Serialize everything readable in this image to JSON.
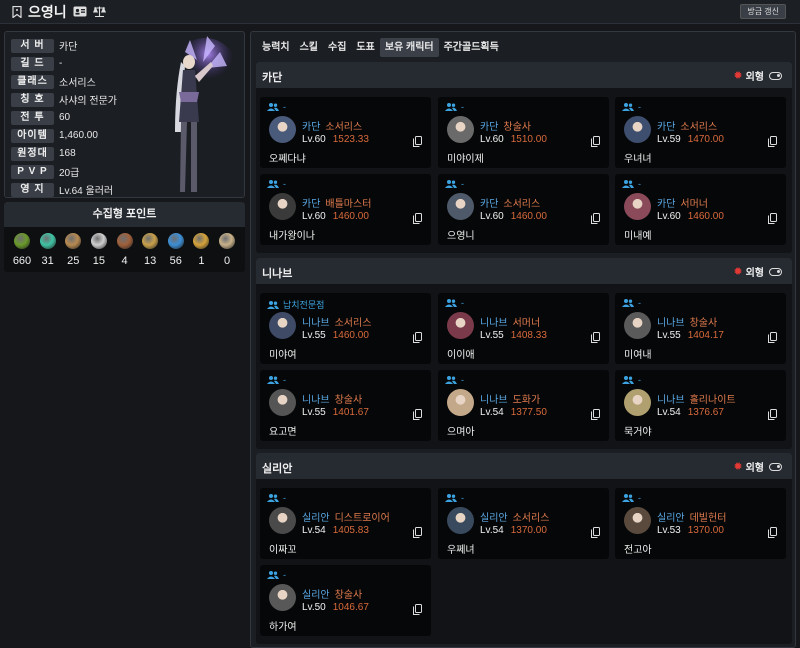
{
  "header": {
    "name": "으영니",
    "refresh_label": "방금 갱신"
  },
  "profile": {
    "rows": [
      {
        "label": "서 버",
        "value": "카단"
      },
      {
        "label": "길 드",
        "value": "-"
      },
      {
        "label": "클래스",
        "value": "소서리스"
      },
      {
        "label": "칭 호",
        "value": "사샤의 전문가"
      },
      {
        "label": "전 투",
        "value": "60"
      },
      {
        "label": "아이템",
        "value": "1,460.00"
      },
      {
        "label": "원정대",
        "value": "168"
      },
      {
        "label": "P V P",
        "value": "20급"
      },
      {
        "label": "영 지",
        "value": "Lv.64 울러러"
      }
    ]
  },
  "collect": {
    "title": "수집형 포인트",
    "items": [
      {
        "icon": "mokoko-seed-icon",
        "value": "660",
        "color": "#6a9a2a"
      },
      {
        "icon": "island-heart-icon",
        "value": "31",
        "color": "#3fc4a4"
      },
      {
        "icon": "great-art-icon",
        "value": "25",
        "color": "#b88a50"
      },
      {
        "icon": "ignea-token-icon",
        "value": "15",
        "color": "#cfcfcf"
      },
      {
        "icon": "adventure-book-icon",
        "value": "4",
        "color": "#a0603a"
      },
      {
        "icon": "voyage-icon",
        "value": "13",
        "color": "#c9a04a"
      },
      {
        "icon": "world-tree-leaf-icon",
        "value": "56",
        "color": "#3c8fd6"
      },
      {
        "icon": "orpheus-star-icon",
        "value": "1",
        "color": "#d6a33a"
      },
      {
        "icon": "giant-heart-icon",
        "value": "0",
        "color": "#c9b28a"
      }
    ]
  },
  "tabs": [
    "능력치",
    "스킬",
    "수집",
    "도표",
    "보유 캐릭터",
    "주간골드획득"
  ],
  "active_tab": 4,
  "outfit_label": "외형",
  "servers": [
    {
      "name": "카단",
      "characters": [
        {
          "guild": "-",
          "server": "카단",
          "class": "소서리스",
          "level": "Lv.60",
          "item_level": "1523.33",
          "name": "오쩨다냐",
          "avatar": "#4a5a7a"
        },
        {
          "guild": "-",
          "server": "카단",
          "class": "창술사",
          "level": "Lv.60",
          "item_level": "1510.00",
          "name": "미야이제",
          "avatar": "#6a6a6a"
        },
        {
          "guild": "-",
          "server": "카단",
          "class": "소서리스",
          "level": "Lv.59",
          "item_level": "1470.00",
          "name": "우녀녀",
          "avatar": "#3e4e6e"
        },
        {
          "guild": "-",
          "server": "카단",
          "class": "배틀마스터",
          "level": "Lv.60",
          "item_level": "1460.00",
          "name": "내가왕이나",
          "avatar": "#3a3a3a"
        },
        {
          "guild": "-",
          "server": "카단",
          "class": "소서리스",
          "level": "Lv.60",
          "item_level": "1460.00",
          "name": "으영니",
          "avatar": "#4e5a6a"
        },
        {
          "guild": "-",
          "server": "카단",
          "class": "서머너",
          "level": "Lv.60",
          "item_level": "1460.00",
          "name": "미내예",
          "avatar": "#8a4a5a"
        }
      ]
    },
    {
      "name": "니나브",
      "characters": [
        {
          "guild": "납치전문점",
          "server": "니나브",
          "class": "소서리스",
          "level": "Lv.55",
          "item_level": "1460.00",
          "name": "미야여",
          "avatar": "#3e4a66"
        },
        {
          "guild": "-",
          "server": "니나브",
          "class": "서머너",
          "level": "Lv.55",
          "item_level": "1408.33",
          "name": "이이애",
          "avatar": "#7a3a4a"
        },
        {
          "guild": "-",
          "server": "니나브",
          "class": "창술사",
          "level": "Lv.55",
          "item_level": "1404.17",
          "name": "미여내",
          "avatar": "#5a5a5a"
        },
        {
          "guild": "-",
          "server": "니나브",
          "class": "창술사",
          "level": "Lv.55",
          "item_level": "1401.67",
          "name": "요고면",
          "avatar": "#555555"
        },
        {
          "guild": "-",
          "server": "니나브",
          "class": "도화가",
          "level": "Lv.54",
          "item_level": "1377.50",
          "name": "으며아",
          "avatar": "#c4a88a"
        },
        {
          "guild": "-",
          "server": "니나브",
          "class": "홀리나이트",
          "level": "Lv.54",
          "item_level": "1376.67",
          "name": "묵거야",
          "avatar": "#b0a070"
        }
      ]
    },
    {
      "name": "실리안",
      "characters": [
        {
          "guild": "-",
          "server": "실리안",
          "class": "디스트로이어",
          "level": "Lv.54",
          "item_level": "1405.83",
          "name": "이짜꼬",
          "avatar": "#4a4a4a"
        },
        {
          "guild": "-",
          "server": "실리안",
          "class": "소서리스",
          "level": "Lv.54",
          "item_level": "1370.00",
          "name": "우쩨녀",
          "avatar": "#3a4a5e"
        },
        {
          "guild": "-",
          "server": "실리안",
          "class": "데빌헌터",
          "level": "Lv.53",
          "item_level": "1370.00",
          "name": "전고아",
          "avatar": "#5a4a3e"
        },
        {
          "guild": "-",
          "server": "실리안",
          "class": "창술사",
          "level": "Lv.50",
          "item_level": "1046.67",
          "name": "하가여",
          "avatar": "#585858"
        }
      ]
    }
  ]
}
